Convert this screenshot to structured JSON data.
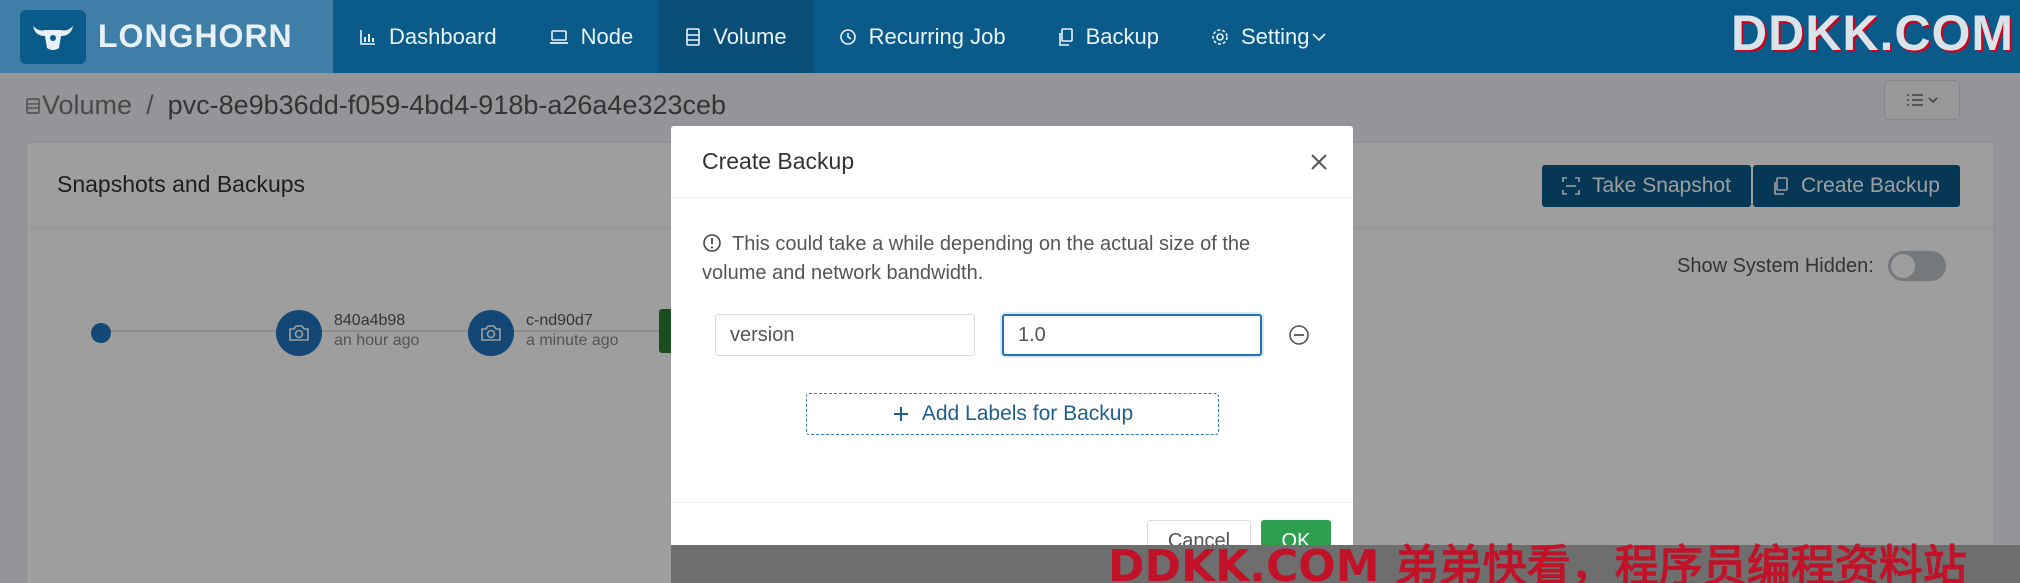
{
  "brand": {
    "name": "LONGHORN"
  },
  "nav": {
    "items": [
      {
        "label": "Dashboard",
        "icon": "bar-chart-icon"
      },
      {
        "label": "Node",
        "icon": "laptop-icon"
      },
      {
        "label": "Volume",
        "icon": "volume-icon",
        "active": true
      },
      {
        "label": "Recurring Job",
        "icon": "clock-icon"
      },
      {
        "label": "Backup",
        "icon": "copy-icon"
      },
      {
        "label": "Setting",
        "icon": "gear-icon"
      }
    ]
  },
  "watermark_top": "DDKK.COM",
  "breadcrumb": {
    "root": "Volume",
    "separator": "/",
    "current": "pvc-8e9b36dd-f059-4bd4-918b-a26a4e323ceb"
  },
  "card": {
    "title": "Snapshots and Backups",
    "take_snapshot": "Take Snapshot",
    "create_backup": "Create Backup",
    "show_hidden_label": "Show System Hidden:",
    "snapshots": [
      {
        "name": "840a4b98",
        "time": "an hour ago"
      },
      {
        "name": "c-nd90d7",
        "time": "a minute ago"
      }
    ]
  },
  "modal": {
    "title": "Create Backup",
    "info": "This could take a while depending on the actual size of the volume and network bandwidth.",
    "label_key": "version",
    "label_value": "1.0",
    "add_labels": "Add Labels for Backup",
    "cancel": "Cancel",
    "ok": "OK"
  },
  "watermark_bottom": "DDKK.COM 弟弟快看，程序员编程资料站"
}
